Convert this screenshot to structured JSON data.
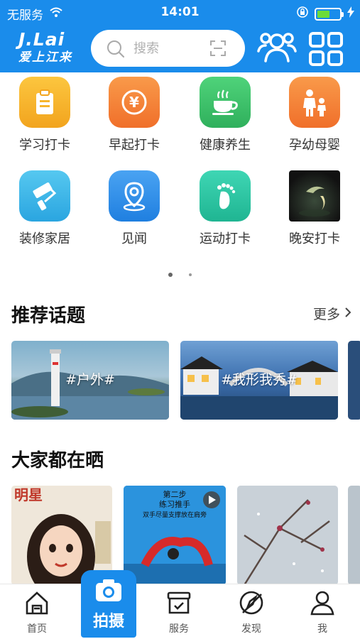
{
  "status_bar": {
    "carrier": "无服务",
    "time": "14:01",
    "battery_level": 0.55
  },
  "header": {
    "logo_top": "J.Lai",
    "logo_sub": "爱上江来",
    "search_placeholder": "搜索"
  },
  "categories": [
    {
      "label": "学习打卡",
      "icon": "clipboard-icon",
      "color": "#f7b52c"
    },
    {
      "label": "早起打卡",
      "icon": "yen-coin-icon",
      "color": "#f5813a"
    },
    {
      "label": "健康养生",
      "icon": "tea-cup-icon",
      "color": "#3fc36a"
    },
    {
      "label": "孕幼母婴",
      "icon": "parent-child-icon",
      "color": "#f5813a"
    },
    {
      "label": "装修家居",
      "icon": "paint-roller-icon",
      "color": "#3cb4e8"
    },
    {
      "label": "见闻",
      "icon": "location-pin-icon",
      "color": "#2f8fe8"
    },
    {
      "label": "运动打卡",
      "icon": "footprint-icon",
      "color": "#2fc6a4"
    },
    {
      "label": "晚安打卡",
      "icon": "moon-night-icon",
      "color": "#1d2a2a"
    }
  ],
  "pagination": {
    "current_page": 1,
    "total_pages": 2
  },
  "recommended": {
    "title": "推荐话题",
    "more_label": "更多",
    "topics": [
      "#户外#",
      "#我形我秀#"
    ]
  },
  "sharing": {
    "title": "大家都在晒",
    "photos": [
      {
        "caption": "明星",
        "icon": "cartoon-portrait-icon"
      },
      {
        "caption_line1": "第二步",
        "caption_line2": "练习推手",
        "caption_line3": "双手尽量支撑放在肩旁",
        "icon": "yoga-video-icon"
      },
      {
        "caption": "",
        "icon": "snow-branch-icon"
      }
    ]
  },
  "tabs": [
    {
      "label": "首页",
      "icon": "home-icon"
    },
    {
      "label": "拍摄",
      "icon": "camera-icon"
    },
    {
      "label": "服务",
      "icon": "service-box-icon"
    },
    {
      "label": "发现",
      "icon": "compass-icon"
    },
    {
      "label": "我",
      "icon": "person-icon"
    }
  ],
  "colors": {
    "brand_blue": "#1a8ceb"
  }
}
